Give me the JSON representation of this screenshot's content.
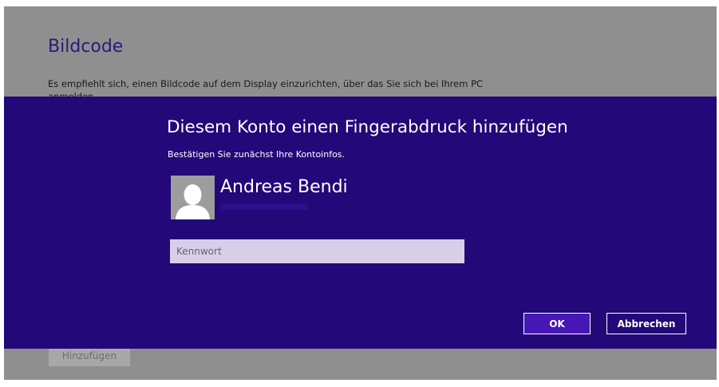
{
  "background_page": {
    "title": "Bildcode",
    "description": "Es empfiehlt sich, einen Bildcode auf dem Display einzurichten, über das Sie sich bei Ihrem PC anmelden",
    "add_button_label": "Hinzufügen"
  },
  "dialog": {
    "title": "Diesem Konto einen Fingerabdruck hinzufügen",
    "subtitle": "Bestätigen Sie zunächst Ihre Kontoinfos.",
    "user": {
      "name": "Andreas Bendi",
      "avatar_icon": "user-silhouette-icon"
    },
    "password": {
      "placeholder": "Kennwort",
      "value": ""
    },
    "ok_label": "OK",
    "cancel_label": "Abbrechen"
  },
  "colors": {
    "dialog_background": "#220878",
    "page_background": "#8f8f8f",
    "ok_button": "#4617b4",
    "title_accent": "#2b1a78"
  }
}
